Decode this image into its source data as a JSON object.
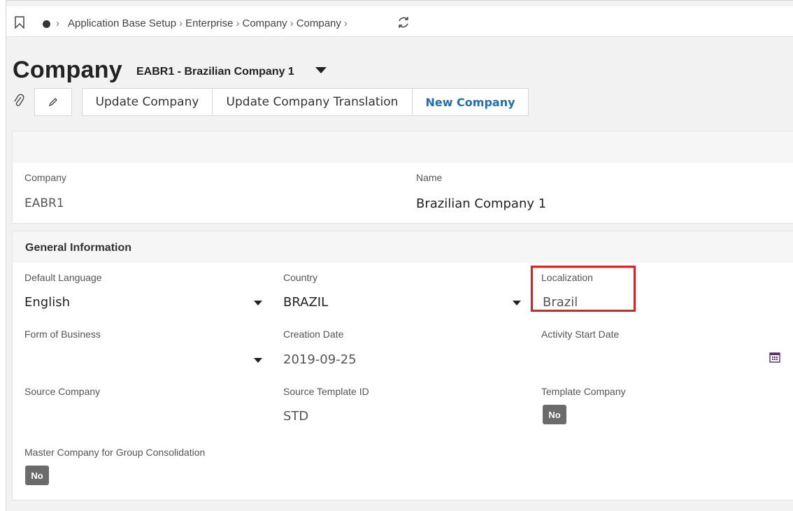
{
  "breadcrumb": {
    "items": [
      "Application Base Setup",
      "Enterprise",
      "Company",
      "Company"
    ]
  },
  "header": {
    "title": "Company",
    "record": "EABR1 - Brazilian Company 1"
  },
  "toolbar": {
    "update_label": "Update Company",
    "translation_label": "Update Company Translation",
    "new_label": "New Company"
  },
  "summary": {
    "company_label": "Company",
    "company_value": "EABR1",
    "name_label": "Name",
    "name_value": "Brazilian Company 1"
  },
  "general": {
    "title": "General Information",
    "default_language_label": "Default Language",
    "default_language_value": "English",
    "country_label": "Country",
    "country_value": "BRAZIL",
    "localization_label": "Localization",
    "localization_value": "Brazil",
    "form_of_business_label": "Form of Business",
    "creation_date_label": "Creation Date",
    "creation_date_value": "2019-09-25",
    "activity_start_label": "Activity Start Date",
    "source_company_label": "Source Company",
    "source_template_label": "Source Template ID",
    "source_template_value": "STD",
    "template_company_label": "Template Company",
    "template_company_value": "No",
    "master_company_label": "Master Company for Group Consolidation",
    "master_company_value": "No"
  },
  "colors": {
    "accent": "#1f6fb5",
    "highlight": "#e02020",
    "badge": "#6b6b6b"
  },
  "icons": [
    "bookmark-icon",
    "home-icon",
    "refresh-icon",
    "paperclip-icon",
    "pencil-icon",
    "chevron-down-icon",
    "calendar-icon"
  ]
}
